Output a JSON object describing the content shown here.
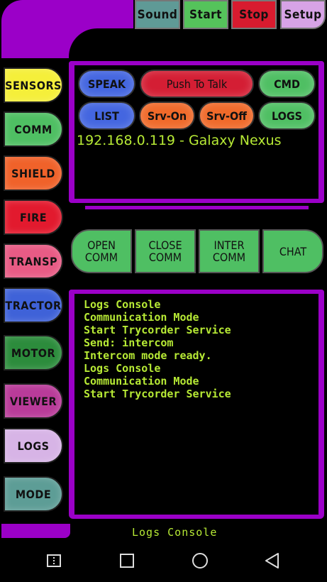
{
  "top_bar": {
    "buttons": [
      {
        "label": "Sound",
        "color": "#5f9a96"
      },
      {
        "label": "Start",
        "color": "#55c35b"
      },
      {
        "label": "Stop",
        "color": "#d81b2f"
      },
      {
        "label": "Setup",
        "color": "#d7a3e6"
      }
    ]
  },
  "sidebar": {
    "items": [
      {
        "label": "SENSORS",
        "color": "#f5ef3a"
      },
      {
        "label": "COMM",
        "color": "#4fbf63"
      },
      {
        "label": "SHIELD",
        "color": "#f0622a"
      },
      {
        "label": "FIRE",
        "color": "#e21a2e"
      },
      {
        "label": "TRANSP",
        "color": "#e85b85"
      },
      {
        "label": "TRACTOR",
        "color": "#3f62d8"
      },
      {
        "label": "MOTOR",
        "color": "#2c8c3c"
      },
      {
        "label": "VIEWER",
        "color": "#b93b99"
      },
      {
        "label": "LOGS",
        "color": "#d7b4e6"
      },
      {
        "label": "MODE",
        "color": "#5d9d96"
      }
    ]
  },
  "control_panel": {
    "row1": [
      {
        "label": "SPEAK",
        "color": "#4466e0"
      },
      {
        "label": "Push To Talk",
        "color": "#d41e34"
      },
      {
        "label": "CMD",
        "color": "#4fbf63"
      }
    ],
    "row2": [
      {
        "label": "LIST",
        "color": "#4466e0"
      },
      {
        "label": "Srv-On",
        "color": "#f06a2a"
      },
      {
        "label": "Srv-Off",
        "color": "#f06a2a"
      },
      {
        "label": "LOGS",
        "color": "#4fbf63"
      }
    ],
    "status": "192.168.0.119 - Galaxy Nexus"
  },
  "comm_buttons": [
    {
      "line1": "OPEN",
      "line2": "COMM"
    },
    {
      "line1": "CLOSE",
      "line2": "COMM"
    },
    {
      "line1": "INTER",
      "line2": "COMM"
    },
    {
      "label": "CHAT"
    }
  ],
  "log_console": {
    "lines": [
      "Logs Console",
      "Communication Mode",
      "Start Trycorder Service",
      "Send: intercom",
      "Intercom mode ready.",
      "Logs Console",
      "Communication Mode",
      "Start Trycorder Service"
    ],
    "footer": "Logs Console"
  },
  "nav_bar": {
    "icons": [
      "menu-icon",
      "recents-icon",
      "home-icon",
      "back-icon"
    ]
  },
  "colors": {
    "frame": "#9b00c8",
    "text_accent": "#b7ea35"
  }
}
